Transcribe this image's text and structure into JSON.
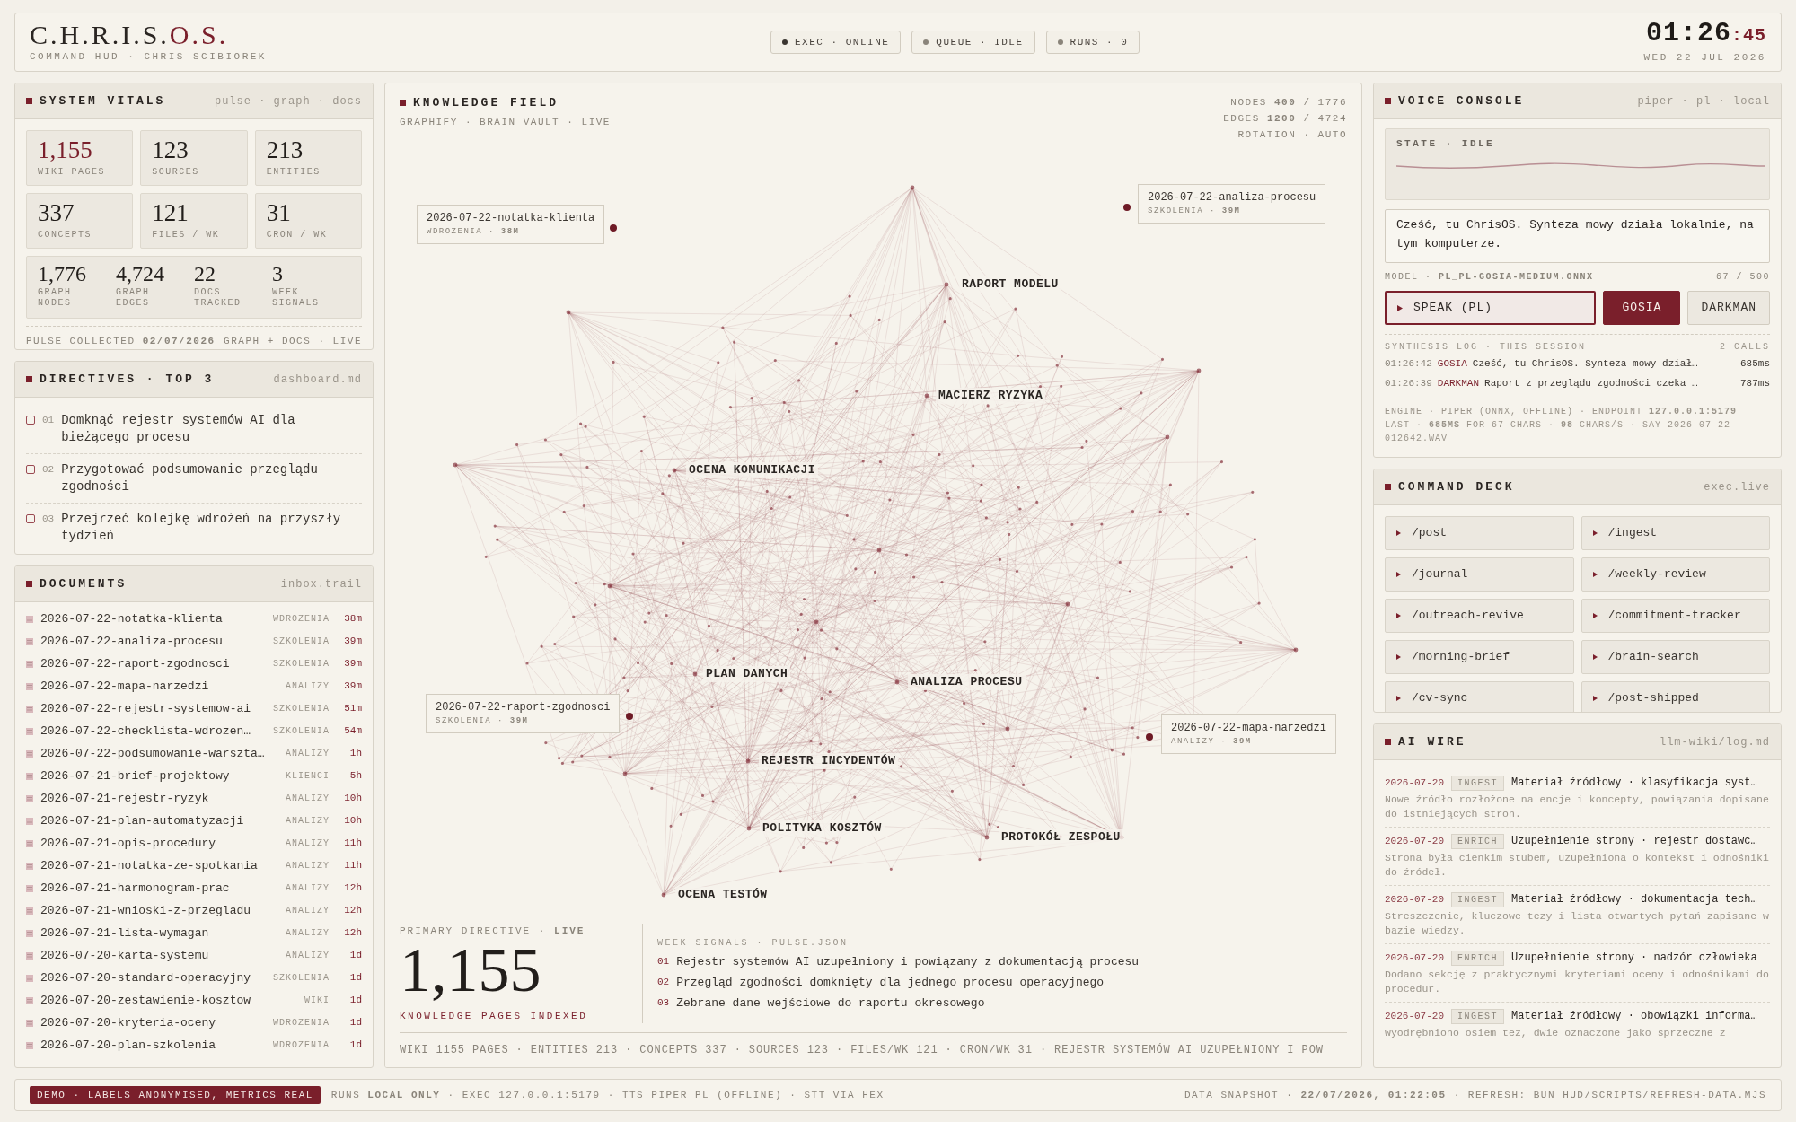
{
  "header": {
    "logo_main": "C.H.R.I.S.",
    "logo_accent": "O.S.",
    "subtitle": "COMMAND HUD · CHRIS SCIBIOREK",
    "status_pills": [
      {
        "label": "EXEC · ONLINE",
        "color": "#3a3530"
      },
      {
        "label": "QUEUE · IDLE",
        "color": "#8a847a"
      },
      {
        "label": "RUNS · 0",
        "color": "#8a847a"
      }
    ],
    "clock": {
      "time": "01:26",
      "seconds": ":45",
      "date": "WED 22 JUL 2026"
    }
  },
  "system_vitals": {
    "title": "SYSTEM VITALS",
    "meta": "pulse · graph · docs",
    "tiles": [
      {
        "value": "1,155",
        "label": "WIKI PAGES",
        "highlight": true
      },
      {
        "value": "123",
        "label": "SOURCES",
        "highlight": false
      },
      {
        "value": "213",
        "label": "ENTITIES",
        "highlight": false
      },
      {
        "value": "337",
        "label": "CONCEPTS",
        "highlight": false
      },
      {
        "value": "121",
        "label": "FILES / WK",
        "highlight": false
      },
      {
        "value": "31",
        "label": "CRON / WK",
        "highlight": false
      }
    ],
    "graph_stats": [
      {
        "value": "1,776",
        "label": "GRAPH NODES"
      },
      {
        "value": "4,724",
        "label": "GRAPH EDGES"
      },
      {
        "value": "22",
        "label": "DOCS TRACKED"
      },
      {
        "value": "3",
        "label": "WEEK SIGNALS"
      }
    ],
    "footer_left": "PULSE COLLECTED **02/07/2026**",
    "footer_right": "GRAPH + DOCS · LIVE"
  },
  "directives": {
    "title": "DIRECTIVES · TOP 3",
    "meta": "dashboard.md",
    "items": [
      {
        "number": "01",
        "text": "Domknąć rejestr systemów AI dla bieżącego procesu",
        "checked": false
      },
      {
        "number": "02",
        "text": "Przygotować podsumowanie przeglądu zgodności",
        "checked": false
      },
      {
        "number": "03",
        "text": "Przejrzeć kolejkę wdrożeń na przyszły tydzień",
        "checked": false
      }
    ]
  },
  "documents": {
    "title": "DOCUMENTS",
    "meta": "inbox.trail",
    "rows": [
      {
        "name": "2026-07-22-notatka-klienta",
        "category": "WDROZENIA",
        "age": "38m"
      },
      {
        "name": "2026-07-22-analiza-procesu",
        "category": "SZKOLENIA",
        "age": "39m"
      },
      {
        "name": "2026-07-22-raport-zgodnosci",
        "category": "SZKOLENIA",
        "age": "39m"
      },
      {
        "name": "2026-07-22-mapa-narzedzi",
        "category": "ANALIZY",
        "age": "39m"
      },
      {
        "name": "2026-07-22-rejestr-systemow-ai",
        "category": "SZKOLENIA",
        "age": "51m"
      },
      {
        "name": "2026-07-22-checklista-wdrozen…",
        "category": "SZKOLENIA",
        "age": "54m"
      },
      {
        "name": "2026-07-22-podsumowanie-warszta…",
        "category": "ANALIZY",
        "age": "1h"
      },
      {
        "name": "2026-07-21-brief-projektowy",
        "category": "KLIENCI",
        "age": "5h"
      },
      {
        "name": "2026-07-21-rejestr-ryzyk",
        "category": "ANALIZY",
        "age": "10h"
      },
      {
        "name": "2026-07-21-plan-automatyzacji",
        "category": "ANALIZY",
        "age": "10h"
      },
      {
        "name": "2026-07-21-opis-procedury",
        "category": "ANALIZY",
        "age": "11h"
      },
      {
        "name": "2026-07-21-notatka-ze-spotkania",
        "category": "ANALIZY",
        "age": "11h"
      },
      {
        "name": "2026-07-21-harmonogram-prac",
        "category": "ANALIZY",
        "age": "12h"
      },
      {
        "name": "2026-07-21-wnioski-z-przegladu",
        "category": "ANALIZY",
        "age": "12h"
      },
      {
        "name": "2026-07-21-lista-wymagan",
        "category": "ANALIZY",
        "age": "12h"
      },
      {
        "name": "2026-07-20-karta-systemu",
        "category": "ANALIZY",
        "age": "1d"
      },
      {
        "name": "2026-07-20-standard-operacyjny",
        "category": "SZKOLENIA",
        "age": "1d"
      },
      {
        "name": "2026-07-20-zestawienie-kosztow",
        "category": "WIKI",
        "age": "1d"
      },
      {
        "name": "2026-07-20-kryteria-oceny",
        "category": "WDROZENIA",
        "age": "1d"
      },
      {
        "name": "2026-07-20-plan-szkolenia",
        "category": "WDROZENIA",
        "age": "1d"
      }
    ]
  },
  "knowledge_field": {
    "title": "KNOWLEDGE FIELD",
    "subtitle": "GRAPHIFY · BRAIN VAULT · LIVE",
    "stats": [
      "NODES **400** / 1776",
      "EDGES **1200** / 4724",
      "ROTATION · AUTO"
    ],
    "node_labels": [
      "RAPORT MODELU",
      "MACIERZ RYZYKA",
      "OCENA KOMUNIKACJI",
      "PLAN DANYCH",
      "ANALIZA PROCESU",
      "REJESTR INCYDENTÓW",
      "POLITYKA KOSZTÓW",
      "PROTOKÓŁ ZESPOŁU",
      "OCENA TESTÓW"
    ],
    "callouts": [
      {
        "name": "2026-07-22-notatka-klienta",
        "detail": "WDROZENIA · **38M**"
      },
      {
        "name": "2026-07-22-analiza-procesu",
        "detail": "SZKOLENIA · **39M**"
      },
      {
        "name": "2026-07-22-raport-zgodnosci",
        "detail": "SZKOLENIA · **39M**"
      },
      {
        "name": "2026-07-22-mapa-narzedzi",
        "detail": "ANALIZY · **39M**"
      }
    ],
    "primary_label": "PRIMARY DIRECTIVE · **LIVE**",
    "primary_value": "1,155",
    "primary_caption": "KNOWLEDGE PAGES INDEXED",
    "signals_title": "WEEK SIGNALS · PULSE.JSON",
    "signals": [
      {
        "number": "01",
        "text": "Rejestr systemów AI uzupełniony i powiązany z dokumentacją procesu"
      },
      {
        "number": "02",
        "text": "Przegląd zgodności domknięty dla jednego procesu operacyjnego"
      },
      {
        "number": "03",
        "text": "Zebrane dane wejściowe do raportu okresowego"
      }
    ],
    "ticker": "WIKI 1155 PAGES · ENTITIES 213 · CONCEPTS 337 · SOURCES 123 · FILES/WK 121 · CRON/WK 31 · REJESTR SYSTEMÓW AI UZUPEŁNIONY I POW"
  },
  "voice_console": {
    "title": "VOICE CONSOLE",
    "meta": "piper · pl · local",
    "state": "STATE · **IDLE**",
    "message": "Cześć, tu ChrisOS. Synteza mowy działa lokalnie, na tym komputerze.",
    "model": "MODEL · **PL_PL-GOSIA-MEDIUM.ONNX**",
    "char_count": "67 / 500",
    "speak_label": "SPEAK (PL)",
    "voices": [
      {
        "label": "GOSIA",
        "selected": true
      },
      {
        "label": "DARKMAN",
        "selected": false
      }
    ],
    "log_title": "SYNTHESIS LOG · THIS SESSION",
    "log_count": "2 CALLS",
    "log": [
      {
        "time": "01:26:42",
        "voice": "GOSIA",
        "text": "Cześć, tu ChrisOS. Synteza mowy dział…",
        "duration": "685ms"
      },
      {
        "time": "01:26:39",
        "voice": "DARKMAN",
        "text": "Raport z przeglądu zgodności czeka …",
        "duration": "787ms"
      }
    ],
    "engine_lines": [
      "ENGINE · PIPER (ONNX, OFFLINE) · ENDPOINT **127.0.0.1:5179**",
      "LAST · **685MS** FOR 67 CHARS · **98** CHARS/S · SAY-2026-07-22-012642.WAV"
    ]
  },
  "command_deck": {
    "title": "COMMAND DECK",
    "meta": "exec.live",
    "commands": [
      "/post",
      "/ingest",
      "/journal",
      "/weekly-review",
      "/outreach-revive",
      "/commitment-tracker",
      "/morning-brief",
      "/brain-search",
      "/cv-sync",
      "/post-shipped"
    ]
  },
  "ai_wire": {
    "title": "AI WIRE",
    "meta": "llm-wiki/log.md",
    "entries": [
      {
        "date": "2026-07-20",
        "tag": "INGEST",
        "title": "Materiał źródłowy · klasyfikacja syst…",
        "description": "Nowe źródło rozłożone na encje i koncepty, powiązania dopisane do istniejących stron."
      },
      {
        "date": "2026-07-20",
        "tag": "ENRICH",
        "title": "Uzupełnienie strony · rejestr dostawc…",
        "description": "Strona była cienkim stubem, uzupełniona o kontekst i odnośniki do źródeł."
      },
      {
        "date": "2026-07-20",
        "tag": "INGEST",
        "title": "Materiał źródłowy · dokumentacja tech…",
        "description": "Streszczenie, kluczowe tezy i lista otwartych pytań zapisane w bazie wiedzy."
      },
      {
        "date": "2026-07-20",
        "tag": "ENRICH",
        "title": "Uzupełnienie strony · nadzór człowieka",
        "description": "Dodano sekcję z praktycznymi kryteriami oceny i odnośnikami do procedur."
      },
      {
        "date": "2026-07-20",
        "tag": "INGEST",
        "title": "Materiał źródłowy · obowiązki informa…",
        "description": "Wyodrębniono osiem tez, dwie oznaczone jako sprzeczne z"
      }
    ]
  },
  "footer": {
    "badge": "DEMO · LABELS ANONYMISED, METRICS REAL",
    "left": "RUNS **LOCAL ONLY** · EXEC 127.0.0.1:5179 · TTS PIPER PL (OFFLINE) · STT VIA HEX",
    "right": "DATA SNAPSHOT · **22/07/2026, 01:22:05** · REFRESH: BUN HUD/SCRIPTS/REFRESH-DATA.MJS"
  }
}
